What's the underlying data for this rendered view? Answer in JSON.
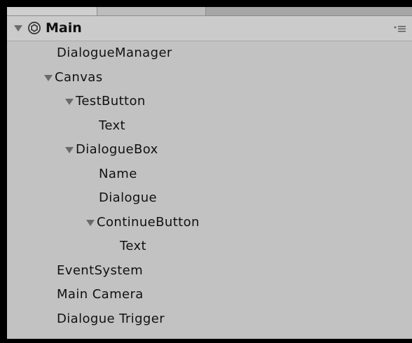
{
  "scene": {
    "name": "Main",
    "expanded": true,
    "icon": "unity-scene-icon",
    "menu_icon": "context-menu-icon"
  },
  "hierarchy": [
    {
      "label": "DialogueManager",
      "depth": 0,
      "expandable": false
    },
    {
      "label": "Canvas",
      "depth": 0,
      "expandable": true
    },
    {
      "label": "TestButton",
      "depth": 1,
      "expandable": true
    },
    {
      "label": "Text",
      "depth": 2,
      "expandable": false
    },
    {
      "label": "DialogueBox",
      "depth": 1,
      "expandable": true
    },
    {
      "label": "Name",
      "depth": 2,
      "expandable": false
    },
    {
      "label": "Dialogue",
      "depth": 2,
      "expandable": false
    },
    {
      "label": "ContinueButton",
      "depth": 2,
      "expandable": true
    },
    {
      "label": "Text",
      "depth": 3,
      "expandable": false
    },
    {
      "label": "EventSystem",
      "depth": 0,
      "expandable": false
    },
    {
      "label": "Main Camera",
      "depth": 0,
      "expandable": false
    },
    {
      "label": "Dialogue Trigger",
      "depth": 0,
      "expandable": false
    }
  ],
  "colors": {
    "panel_bg": "#c2c2c2",
    "frame": "#000000",
    "text": "#111111",
    "foldout_arrow": "#6a6a6a"
  }
}
